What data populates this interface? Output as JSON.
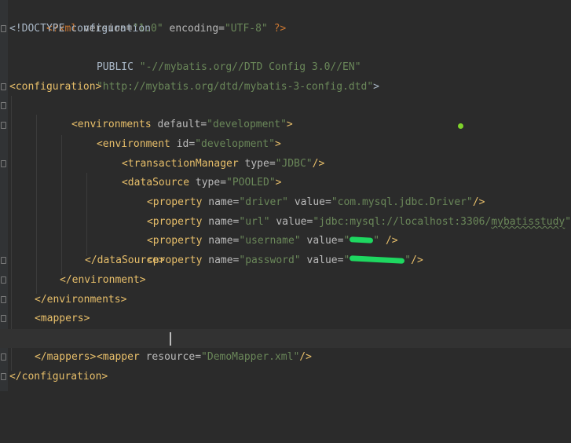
{
  "editor": {
    "language": "xml",
    "lines": {
      "l1": {
        "pi_open": "<?xml ",
        "a1": "version=",
        "v1": "\"1.0\"",
        "a2": " encoding=",
        "v2": "\"UTF-8\"",
        "pi_close": " ?>"
      },
      "l2": {
        "text": "<!DOCTYPE configuration"
      },
      "l3": {
        "kw": "PUBLIC ",
        "val": "\"-//mybatis.org//DTD Config 3.0//EN\""
      },
      "l4": {
        "val": "\"http://mybatis.org/dtd/mybatis-3-config.dtd\"",
        "close": ">"
      },
      "l5": {
        "tag": "<configuration>"
      },
      "l6": {
        "tag": "<environments ",
        "attr": "default=",
        "val": "\"development\"",
        "close": ">"
      },
      "l7": {
        "tag": "<environment ",
        "attr": "id=",
        "val": "\"development\"",
        "close": ">"
      },
      "l8": {
        "tag": "<transactionManager ",
        "attr": "type=",
        "val": "\"JDBC\"",
        "close": "/>"
      },
      "l9": {
        "tag": "<dataSource ",
        "attr": "type=",
        "val": "\"POOLED\"",
        "close": ">"
      },
      "l10": {
        "tag": "<property ",
        "a1": "name=",
        "v1": "\"driver\"",
        "a2": " value=",
        "v2": "\"com.mysql.jdbc.Driver\"",
        "close": "/>"
      },
      "l11": {
        "tag": "<property ",
        "a1": "name=",
        "v1": "\"url\"",
        "a2": " value=",
        "v2_pre": "\"jdbc:mysql://localhost:3306/",
        "v2_url": "mybatisstudy",
        "v2_post": "\"",
        "close": "/>"
      },
      "l12": {
        "tag": "<property ",
        "a1": "name=",
        "v1": "\"username\"",
        "a2": " value=",
        "v2_open": "\"",
        "v2_close": "\"",
        "close": " />"
      },
      "l13": {
        "tag": "<property ",
        "a1": "name=",
        "v1": "\"password\"",
        "a2": " value=",
        "v2_open": "\"",
        "v2_close": "\"",
        "close": "/>"
      },
      "l14": {
        "tag": "</dataSource>"
      },
      "l15": {
        "tag": "</environment>"
      },
      "l16": {
        "tag": "</environments>"
      },
      "l17": {
        "tag": "<mappers>"
      },
      "l18": {
        "tag": "<mapper ",
        "attr": "resource=",
        "v_open": "\"",
        "v_rest": "DemoMapper.xml\"",
        "close": "/>"
      },
      "l19": {
        "tag": "</mappers>"
      },
      "l20": {
        "tag": "</configuration>"
      }
    }
  },
  "colors": {
    "background": "#2b2b2b",
    "tag": "#e8bf6a",
    "attribute": "#bababa",
    "string": "#6a8759",
    "processing_instruction": "#cc7832",
    "redaction": "#1ed760"
  }
}
